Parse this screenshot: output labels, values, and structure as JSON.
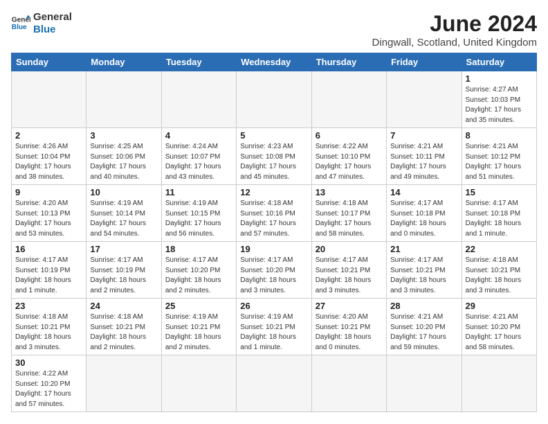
{
  "header": {
    "logo_line1": "General",
    "logo_line2": "Blue",
    "month_title": "June 2024",
    "location": "Dingwall, Scotland, United Kingdom"
  },
  "days_of_week": [
    "Sunday",
    "Monday",
    "Tuesday",
    "Wednesday",
    "Thursday",
    "Friday",
    "Saturday"
  ],
  "weeks": [
    [
      {
        "day": "",
        "info": "",
        "empty": true
      },
      {
        "day": "",
        "info": "",
        "empty": true
      },
      {
        "day": "",
        "info": "",
        "empty": true
      },
      {
        "day": "",
        "info": "",
        "empty": true
      },
      {
        "day": "",
        "info": "",
        "empty": true
      },
      {
        "day": "",
        "info": "",
        "empty": true
      },
      {
        "day": "1",
        "info": "Sunrise: 4:27 AM\nSunset: 10:03 PM\nDaylight: 17 hours\nand 35 minutes.",
        "empty": false
      }
    ],
    [
      {
        "day": "2",
        "info": "Sunrise: 4:26 AM\nSunset: 10:04 PM\nDaylight: 17 hours\nand 38 minutes.",
        "empty": false
      },
      {
        "day": "3",
        "info": "Sunrise: 4:25 AM\nSunset: 10:06 PM\nDaylight: 17 hours\nand 40 minutes.",
        "empty": false
      },
      {
        "day": "4",
        "info": "Sunrise: 4:24 AM\nSunset: 10:07 PM\nDaylight: 17 hours\nand 43 minutes.",
        "empty": false
      },
      {
        "day": "5",
        "info": "Sunrise: 4:23 AM\nSunset: 10:08 PM\nDaylight: 17 hours\nand 45 minutes.",
        "empty": false
      },
      {
        "day": "6",
        "info": "Sunrise: 4:22 AM\nSunset: 10:10 PM\nDaylight: 17 hours\nand 47 minutes.",
        "empty": false
      },
      {
        "day": "7",
        "info": "Sunrise: 4:21 AM\nSunset: 10:11 PM\nDaylight: 17 hours\nand 49 minutes.",
        "empty": false
      },
      {
        "day": "8",
        "info": "Sunrise: 4:21 AM\nSunset: 10:12 PM\nDaylight: 17 hours\nand 51 minutes.",
        "empty": false
      }
    ],
    [
      {
        "day": "9",
        "info": "Sunrise: 4:20 AM\nSunset: 10:13 PM\nDaylight: 17 hours\nand 53 minutes.",
        "empty": false
      },
      {
        "day": "10",
        "info": "Sunrise: 4:19 AM\nSunset: 10:14 PM\nDaylight: 17 hours\nand 54 minutes.",
        "empty": false
      },
      {
        "day": "11",
        "info": "Sunrise: 4:19 AM\nSunset: 10:15 PM\nDaylight: 17 hours\nand 56 minutes.",
        "empty": false
      },
      {
        "day": "12",
        "info": "Sunrise: 4:18 AM\nSunset: 10:16 PM\nDaylight: 17 hours\nand 57 minutes.",
        "empty": false
      },
      {
        "day": "13",
        "info": "Sunrise: 4:18 AM\nSunset: 10:17 PM\nDaylight: 17 hours\nand 58 minutes.",
        "empty": false
      },
      {
        "day": "14",
        "info": "Sunrise: 4:17 AM\nSunset: 10:18 PM\nDaylight: 18 hours\nand 0 minutes.",
        "empty": false
      },
      {
        "day": "15",
        "info": "Sunrise: 4:17 AM\nSunset: 10:18 PM\nDaylight: 18 hours\nand 1 minute.",
        "empty": false
      }
    ],
    [
      {
        "day": "16",
        "info": "Sunrise: 4:17 AM\nSunset: 10:19 PM\nDaylight: 18 hours\nand 1 minute.",
        "empty": false
      },
      {
        "day": "17",
        "info": "Sunrise: 4:17 AM\nSunset: 10:19 PM\nDaylight: 18 hours\nand 2 minutes.",
        "empty": false
      },
      {
        "day": "18",
        "info": "Sunrise: 4:17 AM\nSunset: 10:20 PM\nDaylight: 18 hours\nand 2 minutes.",
        "empty": false
      },
      {
        "day": "19",
        "info": "Sunrise: 4:17 AM\nSunset: 10:20 PM\nDaylight: 18 hours\nand 3 minutes.",
        "empty": false
      },
      {
        "day": "20",
        "info": "Sunrise: 4:17 AM\nSunset: 10:21 PM\nDaylight: 18 hours\nand 3 minutes.",
        "empty": false
      },
      {
        "day": "21",
        "info": "Sunrise: 4:17 AM\nSunset: 10:21 PM\nDaylight: 18 hours\nand 3 minutes.",
        "empty": false
      },
      {
        "day": "22",
        "info": "Sunrise: 4:18 AM\nSunset: 10:21 PM\nDaylight: 18 hours\nand 3 minutes.",
        "empty": false
      }
    ],
    [
      {
        "day": "23",
        "info": "Sunrise: 4:18 AM\nSunset: 10:21 PM\nDaylight: 18 hours\nand 3 minutes.",
        "empty": false
      },
      {
        "day": "24",
        "info": "Sunrise: 4:18 AM\nSunset: 10:21 PM\nDaylight: 18 hours\nand 2 minutes.",
        "empty": false
      },
      {
        "day": "25",
        "info": "Sunrise: 4:19 AM\nSunset: 10:21 PM\nDaylight: 18 hours\nand 2 minutes.",
        "empty": false
      },
      {
        "day": "26",
        "info": "Sunrise: 4:19 AM\nSunset: 10:21 PM\nDaylight: 18 hours\nand 1 minute.",
        "empty": false
      },
      {
        "day": "27",
        "info": "Sunrise: 4:20 AM\nSunset: 10:21 PM\nDaylight: 18 hours\nand 0 minutes.",
        "empty": false
      },
      {
        "day": "28",
        "info": "Sunrise: 4:21 AM\nSunset: 10:20 PM\nDaylight: 17 hours\nand 59 minutes.",
        "empty": false
      },
      {
        "day": "29",
        "info": "Sunrise: 4:21 AM\nSunset: 10:20 PM\nDaylight: 17 hours\nand 58 minutes.",
        "empty": false
      }
    ],
    [
      {
        "day": "30",
        "info": "Sunrise: 4:22 AM\nSunset: 10:20 PM\nDaylight: 17 hours\nand 57 minutes.",
        "empty": false
      },
      {
        "day": "",
        "info": "",
        "empty": true
      },
      {
        "day": "",
        "info": "",
        "empty": true
      },
      {
        "day": "",
        "info": "",
        "empty": true
      },
      {
        "day": "",
        "info": "",
        "empty": true
      },
      {
        "day": "",
        "info": "",
        "empty": true
      },
      {
        "day": "",
        "info": "",
        "empty": true
      }
    ]
  ]
}
